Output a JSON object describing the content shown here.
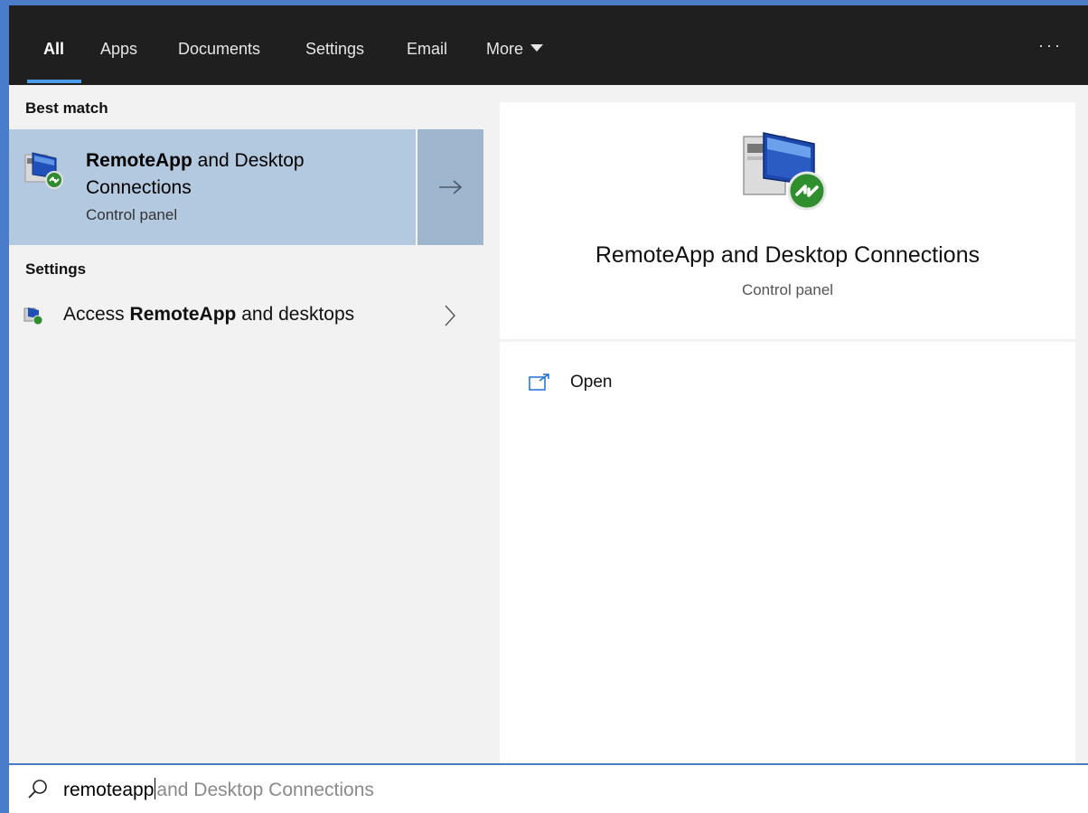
{
  "tabs": [
    {
      "label": "All",
      "active": true
    },
    {
      "label": "Apps"
    },
    {
      "label": "Documents"
    },
    {
      "label": "Settings"
    },
    {
      "label": "Email"
    },
    {
      "label": "More"
    }
  ],
  "overflow_label": "···",
  "left": {
    "best_match_heading": "Best match",
    "best": {
      "title_bold": "RemoteApp",
      "title_rest": " and Desktop Connections",
      "subtitle": "Control panel",
      "arrow": "→"
    },
    "settings_heading": "Settings",
    "setting_item": {
      "prefix": "Access ",
      "bold": "RemoteApp",
      "suffix": " and desktops"
    }
  },
  "right": {
    "title": "RemoteApp and Desktop Connections",
    "subtitle": "Control panel",
    "open_label": "Open"
  },
  "search": {
    "typed": "remoteapp",
    "suggestion": "and Desktop Connections"
  },
  "colors": {
    "accent": "#4a7cc9",
    "selected_row": "#b3c9e0",
    "topbar": "#1f1f1f"
  }
}
